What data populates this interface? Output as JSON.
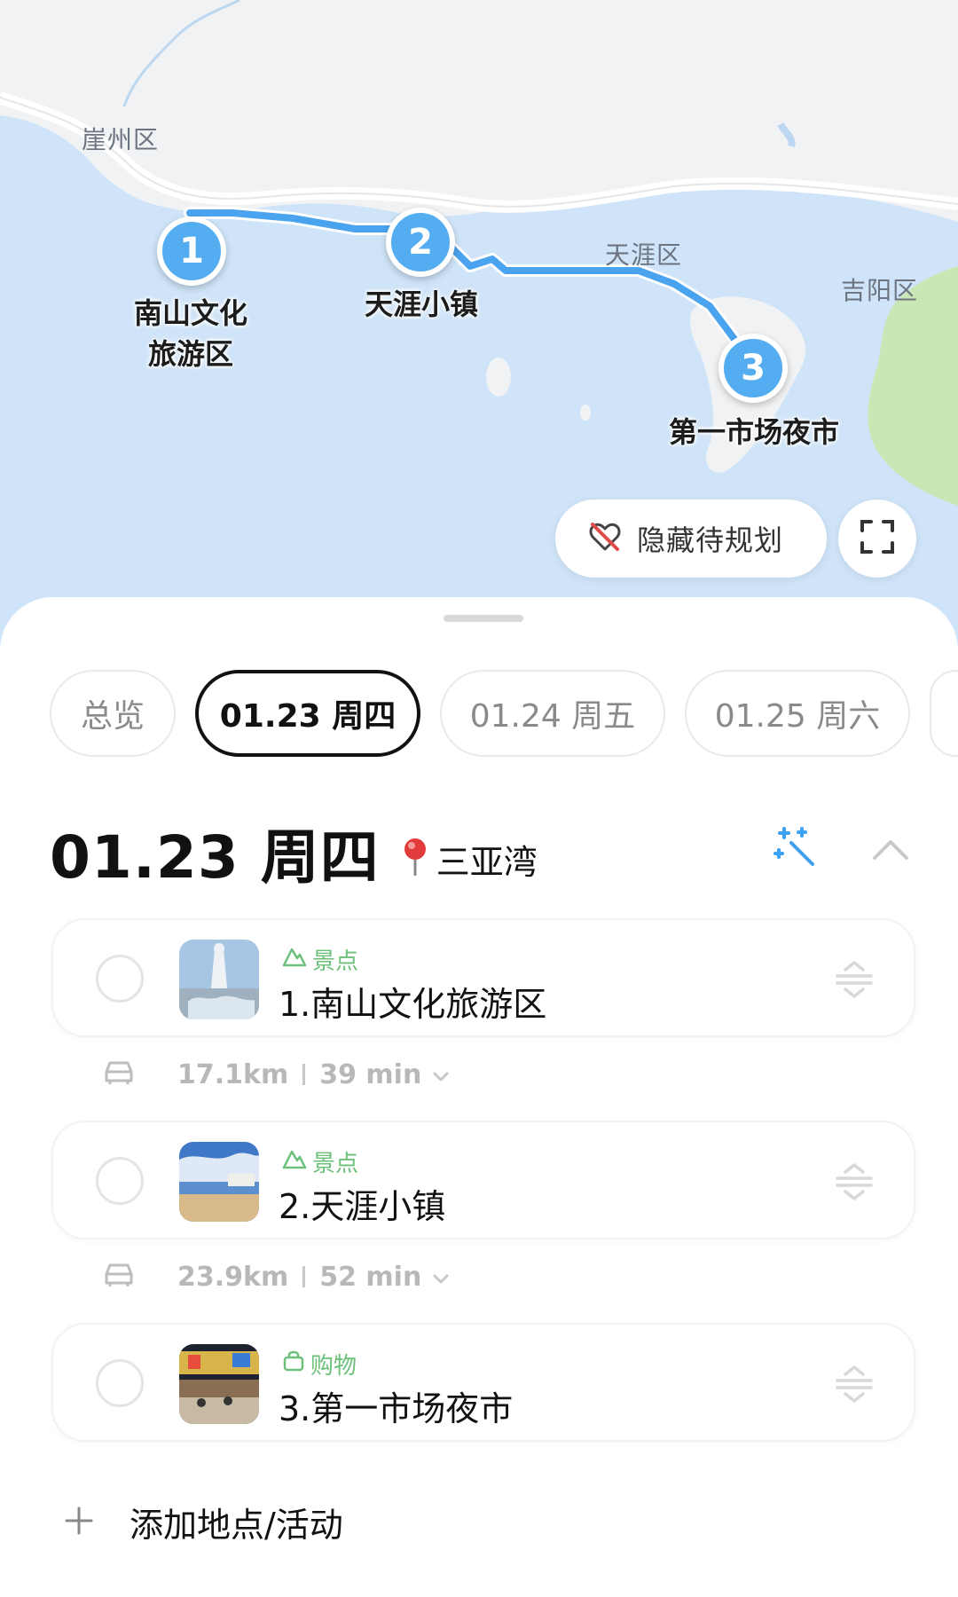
{
  "map": {
    "districts": [
      "崖州区",
      "天涯区",
      "吉阳区"
    ],
    "stops": [
      {
        "number": "1",
        "label": "南山文化\n旅游区"
      },
      {
        "number": "2",
        "label": "天涯小镇"
      },
      {
        "number": "3",
        "label": "第一市场夜市"
      }
    ],
    "hide_button_label": "隐藏待规划",
    "route_color": "#4aa3ee",
    "pin_color": "#53adf0"
  },
  "tabs": [
    "总览",
    "01.23 周四",
    "01.24 周五",
    "01.25 周六"
  ],
  "active_tab_index": 1,
  "day": {
    "title": "01.23 周四",
    "location": "三亚湾",
    "stops": [
      {
        "category": "景点",
        "name": "1.南山文化旅游区",
        "category_icon": "mountain-icon"
      },
      {
        "category": "景点",
        "name": "2.天涯小镇",
        "category_icon": "mountain-icon"
      },
      {
        "category": "购物",
        "name": "3.第一市场夜市",
        "category_icon": "shopping-bag-icon"
      }
    ],
    "legs": [
      {
        "distance": "17.1km",
        "duration": "39 min"
      },
      {
        "distance": "23.9km",
        "duration": "52 min"
      }
    ],
    "add_label": "添加地点/活动"
  },
  "colors": {
    "accent_green": "#6cc07a",
    "magic_blue": "#3da0f0"
  }
}
